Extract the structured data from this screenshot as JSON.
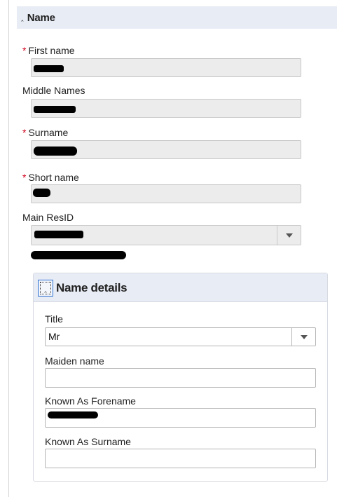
{
  "section": {
    "title": "Name",
    "toggle_icon": "double-chevron-up-icon"
  },
  "fields": {
    "first_name": {
      "label": "First name",
      "required": true,
      "value": ""
    },
    "middle_names": {
      "label": "Middle Names",
      "required": false,
      "value": ""
    },
    "surname": {
      "label": "Surname",
      "required": true,
      "value": ""
    },
    "short_name": {
      "label": "Short name",
      "required": true,
      "value": ""
    },
    "main_resid": {
      "label": "Main ResID",
      "required": false,
      "value": ""
    }
  },
  "required_marker": "*",
  "details": {
    "title": "Name details",
    "toggle_icon": "double-chevron-up-icon",
    "title_field": {
      "label": "Title",
      "value": "Mr"
    },
    "maiden_name": {
      "label": "Maiden name",
      "value": ""
    },
    "known_as_forename": {
      "label": "Known As Forename",
      "value": ""
    },
    "known_as_surname": {
      "label": "Known As Surname",
      "value": ""
    }
  },
  "colors": {
    "required": "#d0021b",
    "header_bg": "#e8ecf5",
    "input_bg": "#ececec",
    "focus_border": "#2b6fd1"
  }
}
